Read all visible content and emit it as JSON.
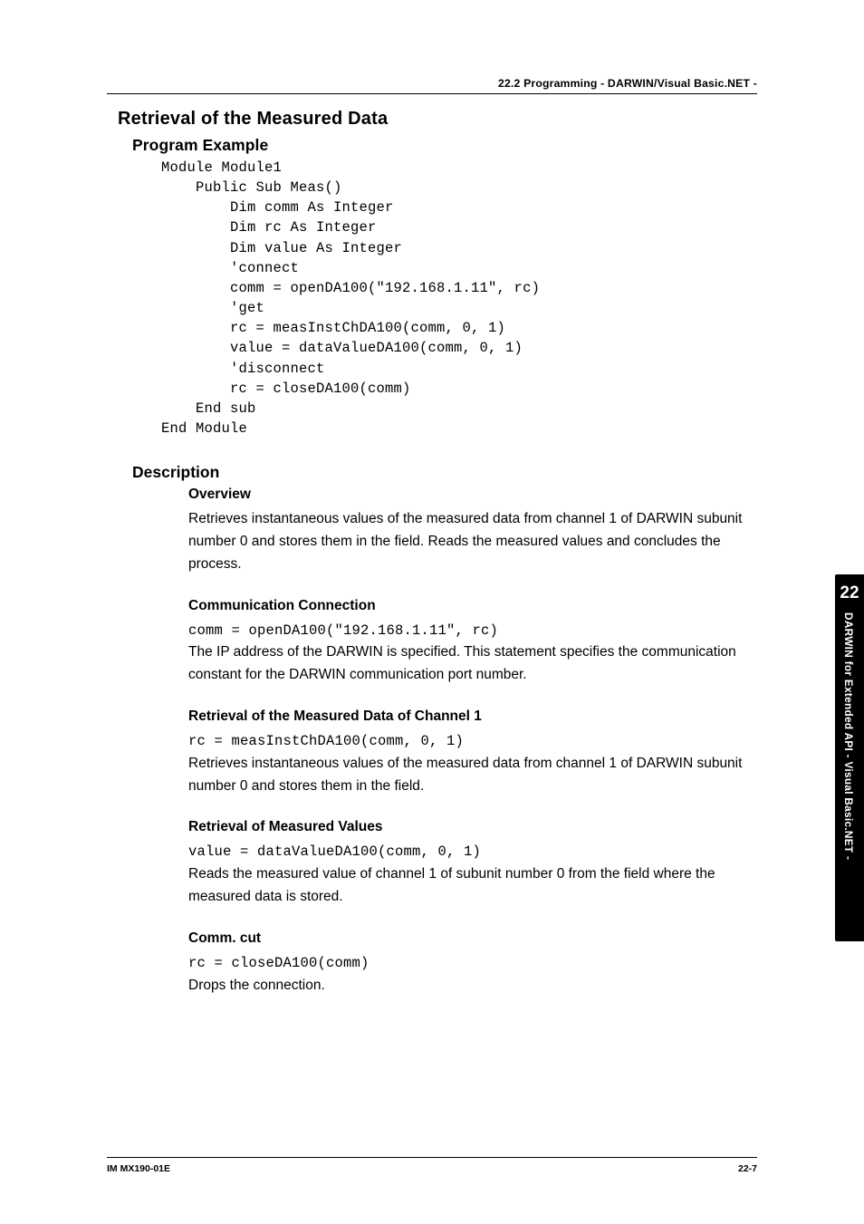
{
  "header": {
    "section_label": "22.2  Programming - DARWIN/Visual Basic.NET -"
  },
  "title": "Retrieval of the Measured Data",
  "program_example": {
    "heading": "Program Example",
    "code": "Module Module1\n    Public Sub Meas()\n        Dim comm As Integer\n        Dim rc As Integer\n        Dim value As Integer\n        'connect\n        comm = openDA100(\"192.168.1.11\", rc)\n        'get\n        rc = measInstChDA100(comm, 0, 1)\n        value = dataValueDA100(comm, 0, 1)\n        'disconnect\n        rc = closeDA100(comm)\n    End sub\nEnd Module"
  },
  "description": {
    "heading": "Description",
    "overview": {
      "heading": "Overview",
      "text": "Retrieves instantaneous values of the measured data from channel 1 of DARWIN subunit number 0 and stores them in the field. Reads the measured values and concludes the process."
    },
    "comm_conn": {
      "heading": "Communication Connection",
      "code": "comm = openDA100(\"192.168.1.11\", rc)",
      "text": "The IP address of the DARWIN is specified. This statement specifies the communication constant for the DARWIN communication port number."
    },
    "retrieval_ch1": {
      "heading": "Retrieval of the Measured Data of Channel 1",
      "code": "rc = measInstChDA100(comm, 0, 1)",
      "text": "Retrieves instantaneous values of the measured data from channel 1 of DARWIN subunit number 0 and stores them in the field."
    },
    "retrieval_values": {
      "heading": "Retrieval of Measured Values",
      "code": "value = dataValueDA100(comm, 0, 1)",
      "text": "Reads the measured value of channel 1 of subunit number 0 from the field where the measured data is stored."
    },
    "comm_cut": {
      "heading": "Comm. cut",
      "code": "rc = closeDA100(comm)",
      "text": "Drops the connection."
    }
  },
  "right_tab": {
    "number": "22",
    "text": "DARWIN for Extended API - Visual Basic.NET -"
  },
  "footer": {
    "left": "IM MX190-01E",
    "right": "22-7"
  }
}
